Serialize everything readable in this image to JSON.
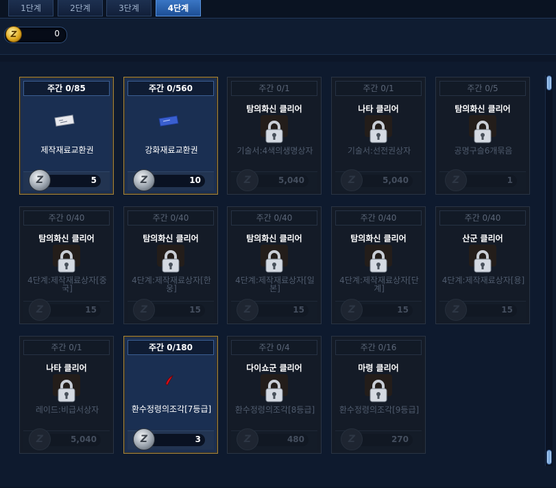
{
  "tabs": [
    {
      "label": "1단계"
    },
    {
      "label": "2단계"
    },
    {
      "label": "3단계"
    },
    {
      "label": "4단계",
      "active": true
    }
  ],
  "currency": {
    "value": "0",
    "icon": "gold-coin-icon"
  },
  "colors": {
    "accent_gold": "#a5863f",
    "tab_active": "#3a76c4",
    "background": "#0e1a2e"
  },
  "items": [
    {
      "limit": "주간 0/85",
      "condition": "",
      "name": "제작재료교환권",
      "price": "5",
      "locked": false,
      "icon": "ticket-icon"
    },
    {
      "limit": "주간 0/560",
      "condition": "",
      "name": "강화재료교환권",
      "price": "10",
      "locked": false,
      "icon": "blue-ticket-icon"
    },
    {
      "limit": "주간 0/1",
      "condition": "탐의화신 클리어",
      "name": "기술서:4색의생명상자",
      "price": "5,040",
      "locked": true
    },
    {
      "limit": "주간 0/1",
      "condition": "나타 클리어",
      "name": "기술서:선전권상자",
      "price": "5,040",
      "locked": true
    },
    {
      "limit": "주간 0/5",
      "condition": "탐의화신 클리어",
      "name": "공명구슬6개묶음",
      "price": "1",
      "locked": true
    },
    {
      "limit": "주간 0/40",
      "condition": "탐의화신 클리어",
      "name": "4단계:제작재료상자[중국]",
      "price": "15",
      "locked": true
    },
    {
      "limit": "주간 0/40",
      "condition": "탐의화신 클리어",
      "name": "4단계:제작재료상자[한웅]",
      "price": "15",
      "locked": true
    },
    {
      "limit": "주간 0/40",
      "condition": "탐의화신 클리어",
      "name": "4단계:제작재료상자[일본]",
      "price": "15",
      "locked": true
    },
    {
      "limit": "주간 0/40",
      "condition": "탐의화신 클리어",
      "name": "4단계:제작재료상자[단계]",
      "price": "15",
      "locked": true
    },
    {
      "limit": "주간 0/40",
      "condition": "산군 클리어",
      "name": "4단계:제작재료상자[용]",
      "price": "15",
      "locked": true
    },
    {
      "limit": "주간 0/1",
      "condition": "나타 클리어",
      "name": "레이드:비급서상자",
      "price": "5,040",
      "locked": true
    },
    {
      "limit": "주간 0/180",
      "condition": "",
      "name": "환수정령의조각[7등급]",
      "price": "3",
      "locked": false,
      "icon": "red-feather-icon"
    },
    {
      "limit": "주간 0/4",
      "condition": "다이쇼군 클리어",
      "name": "환수정령의조각[8등급]",
      "price": "480",
      "locked": true
    },
    {
      "limit": "주간 0/16",
      "condition": "마령 클리어",
      "name": "환수정령의조각[9등급]",
      "price": "270",
      "locked": true
    }
  ]
}
